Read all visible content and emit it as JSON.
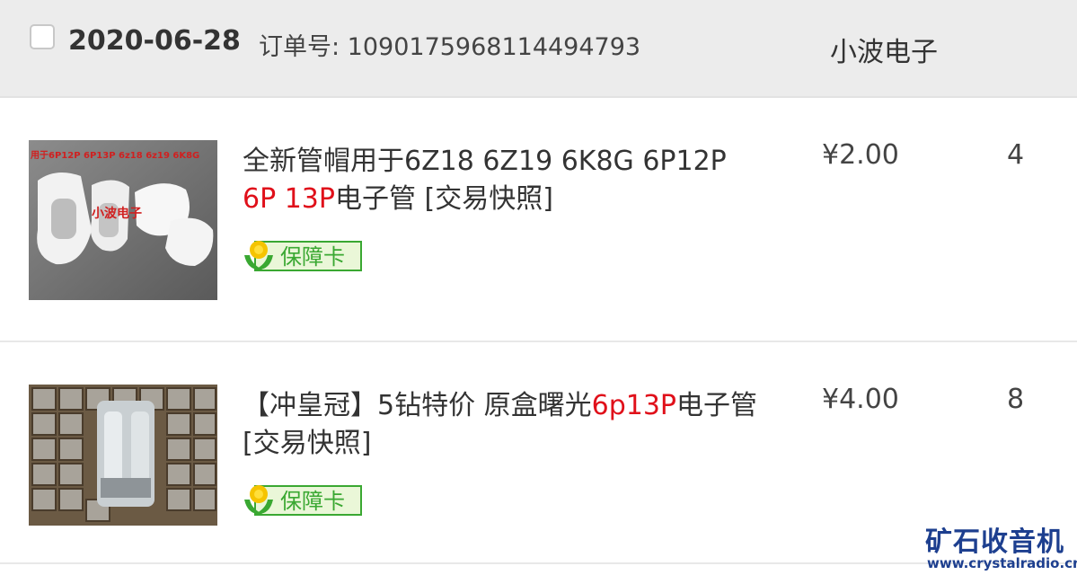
{
  "order": {
    "date": "2020-06-28",
    "order_number_text": "订单号: 1090175968114494793",
    "shop_name": "小波电子"
  },
  "items": [
    {
      "title_before": "全新管帽用于6Z18 6Z19 6K8G 6P12P ",
      "title_highlight": "6P 13P",
      "title_after": "电子管 [交易快照]",
      "image_caption": "小波电子",
      "image_top_text": "用于6P12P 6P13P 6z18 6z19 6K8G",
      "badge_label": "保障卡",
      "price": "¥2.00",
      "quantity": "4"
    },
    {
      "title_before": "【冲皇冠】5钻特价 原盒曙光",
      "title_highlight": "6p13P",
      "title_after": "电子管 [交易快照]",
      "badge_label": "保障卡",
      "price": "¥4.00",
      "quantity": "8"
    }
  ],
  "watermark": {
    "title": "矿石收音机",
    "url": "www.crystalradio.cn"
  },
  "colors": {
    "header_bg": "#ececec",
    "highlight_red": "#e0101a",
    "badge_green": "#3aa832",
    "watermark_blue": "#1d3f8f"
  }
}
